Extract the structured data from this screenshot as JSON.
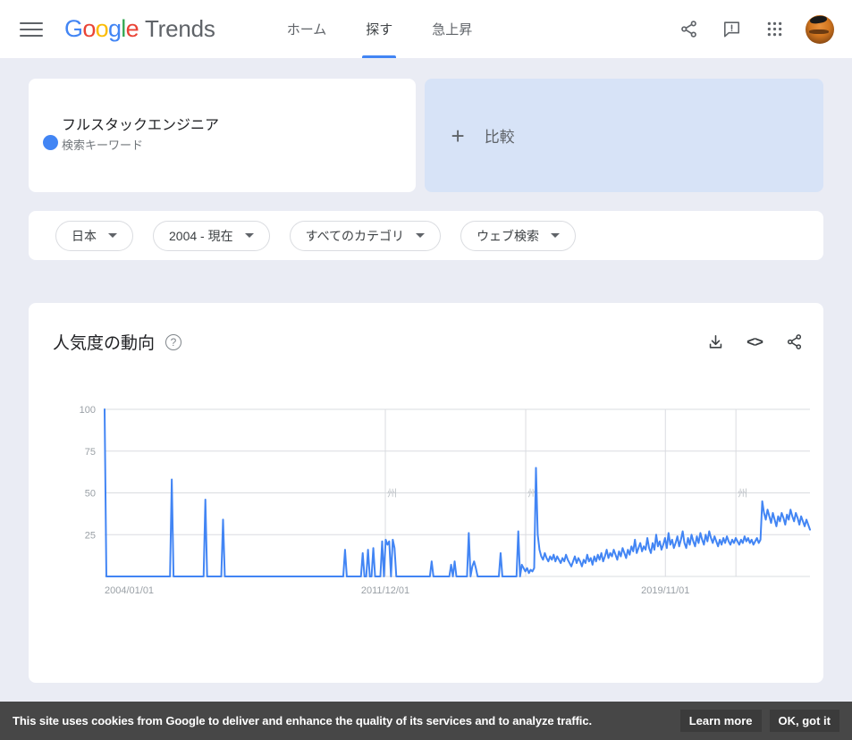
{
  "header": {
    "menu_icon": "hamburger-menu-icon",
    "logo_google": "Google",
    "logo_trends": "Trends",
    "nav": [
      {
        "label": "ホーム",
        "active": false
      },
      {
        "label": "探す",
        "active": true
      },
      {
        "label": "急上昇",
        "active": false
      }
    ],
    "icons": [
      "share-icon",
      "feedback-icon",
      "apps-grid-icon"
    ],
    "avatar": "user-avatar"
  },
  "search_term": {
    "title": "フルスタックエンジニア",
    "subtitle": "検索キーワード",
    "dot_color": "#4285f4"
  },
  "compare": {
    "plus": "+",
    "label": "比較"
  },
  "filters": [
    {
      "label": "日本"
    },
    {
      "label": "2004 - 現在"
    },
    {
      "label": "すべてのカテゴリ"
    },
    {
      "label": "ウェブ検索"
    }
  ],
  "chart_card": {
    "title": "人気度の動向",
    "help": "?",
    "actions": [
      "download-icon",
      "embed-code-icon",
      "share-icon"
    ]
  },
  "cookie_banner": {
    "text": "This site uses cookies from Google to deliver and enhance the quality of its services and to analyze traffic.",
    "learn_more": "Learn more",
    "ok": "OK, got it"
  },
  "chart_data": {
    "type": "line",
    "title": "人気度の動向",
    "xlabel": "",
    "ylabel": "",
    "ylim": [
      0,
      100
    ],
    "grid": true,
    "legend": "none",
    "line_color": "#4285f4",
    "x_tick_labels": [
      "2004/01/01",
      "2011/12/01",
      "2019/11/01"
    ],
    "x_tick_positions": [
      0,
      0.398,
      0.795
    ],
    "y_tick_labels": [
      "100",
      "75",
      "50",
      "25"
    ],
    "y_tick_values": [
      100,
      75,
      50,
      25
    ],
    "annotation_markers": [
      {
        "x": 0.398,
        "glyph": "州"
      },
      {
        "x": 0.597,
        "glyph": "州"
      },
      {
        "x": 0.895,
        "glyph": "州"
      }
    ],
    "series": [
      {
        "name": "フルスタックエンジニア",
        "values": [
          100,
          0,
          0,
          0,
          0,
          0,
          0,
          0,
          0,
          0,
          0,
          0,
          0,
          0,
          0,
          0,
          0,
          0,
          0,
          0,
          0,
          0,
          0,
          0,
          0,
          0,
          0,
          0,
          0,
          0,
          0,
          0,
          0,
          0,
          0,
          0,
          0,
          0,
          58,
          0,
          0,
          0,
          0,
          0,
          0,
          0,
          0,
          0,
          0,
          0,
          0,
          0,
          0,
          0,
          0,
          0,
          0,
          46,
          0,
          0,
          0,
          0,
          0,
          0,
          0,
          0,
          0,
          34,
          0,
          0,
          0,
          0,
          0,
          0,
          0,
          0,
          0,
          0,
          0,
          0,
          0,
          0,
          0,
          0,
          0,
          0,
          0,
          0,
          0,
          0,
          0,
          0,
          0,
          0,
          0,
          0,
          0,
          0,
          0,
          0,
          0,
          0,
          0,
          0,
          0,
          0,
          0,
          0,
          0,
          0,
          0,
          0,
          0,
          0,
          0,
          0,
          0,
          0,
          0,
          0,
          0,
          0,
          0,
          0,
          0,
          0,
          0,
          0,
          0,
          0,
          0,
          0,
          0,
          0,
          0,
          0,
          16,
          0,
          0,
          0,
          0,
          0,
          0,
          0,
          0,
          0,
          14,
          0,
          0,
          16,
          0,
          0,
          17,
          0,
          0,
          0,
          0,
          21,
          0,
          22,
          19,
          21,
          0,
          22,
          17,
          0,
          0,
          0,
          0,
          0,
          0,
          0,
          0,
          0,
          0,
          0,
          0,
          0,
          0,
          0,
          0,
          0,
          0,
          0,
          0,
          9,
          0,
          0,
          0,
          0,
          0,
          0,
          0,
          0,
          0,
          0,
          7,
          0,
          9,
          0,
          0,
          0,
          0,
          0,
          0,
          0,
          26,
          0,
          6,
          9,
          5,
          0,
          0,
          0,
          0,
          0,
          0,
          0,
          0,
          0,
          0,
          0,
          0,
          0,
          14,
          0,
          0,
          0,
          0,
          0,
          0,
          0,
          0,
          0,
          27,
          0,
          7,
          5,
          3,
          5,
          2,
          4,
          3,
          5,
          65,
          25,
          16,
          12,
          10,
          14,
          11,
          9,
          12,
          10,
          13,
          9,
          12,
          10,
          8,
          11,
          9,
          13,
          10,
          8,
          6,
          9,
          12,
          8,
          11,
          9,
          6,
          10,
          8,
          13,
          9,
          11,
          7,
          12,
          9,
          13,
          10,
          14,
          9,
          12,
          16,
          11,
          14,
          12,
          16,
          13,
          10,
          15,
          12,
          17,
          14,
          11,
          16,
          13,
          18,
          15,
          22,
          14,
          17,
          20,
          15,
          18,
          16,
          23,
          17,
          14,
          20,
          16,
          25,
          18,
          21,
          16,
          19,
          23,
          17,
          26,
          19,
          22,
          17,
          20,
          24,
          18,
          22,
          27,
          20,
          17,
          23,
          19,
          25,
          21,
          18,
          24,
          20,
          26,
          22,
          19,
          25,
          21,
          27,
          23,
          20,
          24,
          21,
          18,
          22,
          19,
          23,
          20,
          24,
          21,
          19,
          22,
          20,
          23,
          21,
          19,
          22,
          20,
          24,
          21,
          23,
          20,
          22,
          19,
          21,
          23,
          20,
          22,
          45,
          38,
          34,
          40,
          36,
          32,
          38,
          34,
          30,
          36,
          33,
          38,
          35,
          31,
          37,
          34,
          40,
          36,
          33,
          38,
          35,
          31,
          36,
          33,
          30,
          34,
          31,
          28
        ]
      }
    ]
  }
}
